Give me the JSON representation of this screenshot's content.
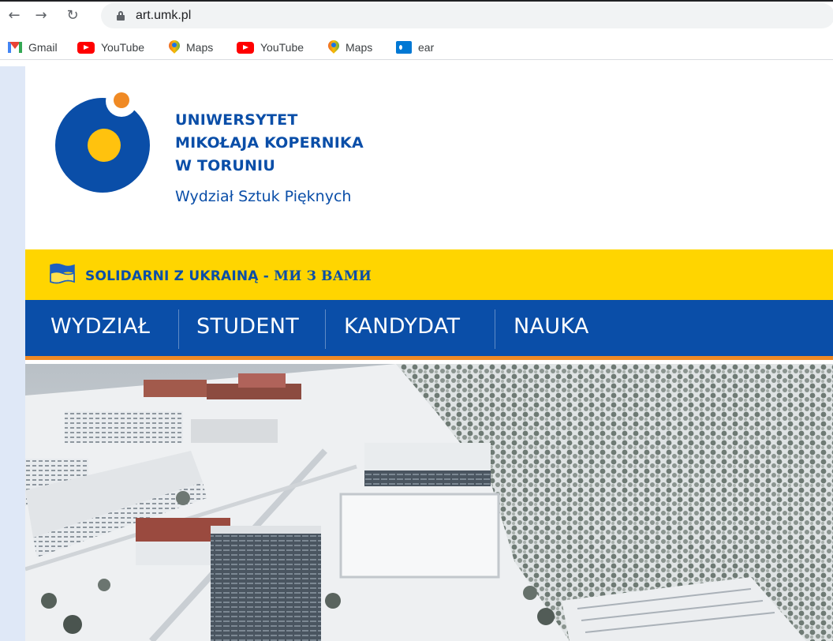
{
  "browser": {
    "url": "art.umk.pl",
    "bookmarks": [
      {
        "label": "Gmail",
        "icon": "gmail-icon"
      },
      {
        "label": "YouTube",
        "icon": "youtube-icon"
      },
      {
        "label": "Maps",
        "icon": "maps-icon"
      },
      {
        "label": "YouTube",
        "icon": "youtube-icon"
      },
      {
        "label": "Maps",
        "icon": "maps-icon"
      },
      {
        "label": "ear",
        "icon": "outlook-icon"
      }
    ]
  },
  "header": {
    "uni_line1": "UNIWERSYTET",
    "uni_line2": "MIKOŁAJA KOPERNIKA",
    "uni_line3": "W TORUNIU",
    "faculty": "Wydział Sztuk Pięknych"
  },
  "banner": {
    "text": "SOLIDARNI Z UKRAINĄ",
    "dash": " - ",
    "text_cyrillic": "МИ З ВАМИ"
  },
  "nav": {
    "items": [
      "WYDZIAŁ",
      "STUDENT",
      "KANDYDAT",
      "NAUKA"
    ]
  },
  "colors": {
    "brand_blue": "#0a4ea8",
    "brand_yellow": "#ffd500",
    "accent_orange": "#f08a24"
  }
}
